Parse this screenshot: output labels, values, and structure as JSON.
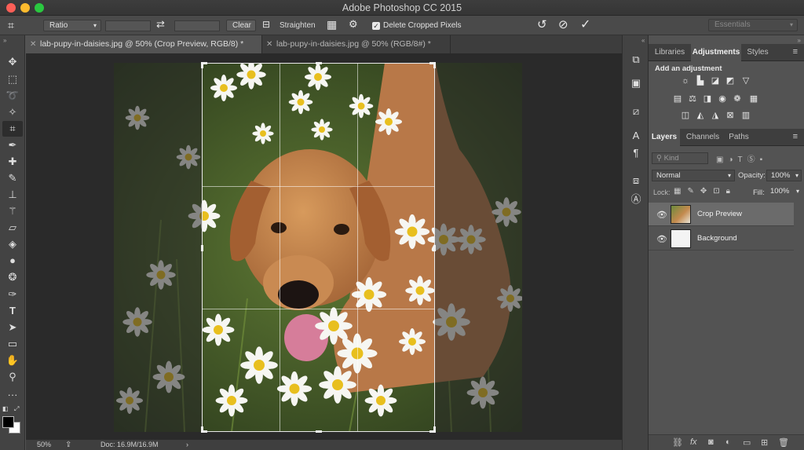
{
  "window": {
    "title": "Adobe Photoshop CC 2015"
  },
  "options_bar": {
    "ratio_label": "Ratio",
    "clear_label": "Clear",
    "straighten_label": "Straighten",
    "delete_cropped_label": "Delete Cropped Pixels",
    "delete_cropped_checked": true,
    "workspace_label": "Essentials"
  },
  "doc_tabs": [
    {
      "title": "lab-pupy-in-daisies.jpg @ 50% (Crop Preview, RGB/8) *",
      "active": true
    },
    {
      "title": "lab-pupy-in-daisies.jpg @ 50% (RGB/8#) *",
      "active": false
    }
  ],
  "status_bar": {
    "zoom": "50%",
    "doc_size": "Doc: 16.9M/16.9M"
  },
  "panels": {
    "top_tabs": [
      "Libraries",
      "Adjustments",
      "Styles"
    ],
    "top_active": "Adjustments",
    "adjustments_heading": "Add an adjustment",
    "layers_tabs": [
      "Layers",
      "Channels",
      "Paths"
    ],
    "layers_active": "Layers",
    "kind_placeholder": "Kind",
    "blend_mode": "Normal",
    "opacity_label": "Opacity:",
    "opacity_value": "100%",
    "lock_label": "Lock:",
    "fill_label": "Fill:",
    "fill_value": "100%",
    "layers": [
      {
        "name": "Crop Preview",
        "selected": true
      },
      {
        "name": "Background",
        "selected": false
      }
    ]
  },
  "colors": {
    "accent_ui": "#535353",
    "canvas_bg": "#2a2a2a",
    "crop_border": "#e8e8e8"
  }
}
